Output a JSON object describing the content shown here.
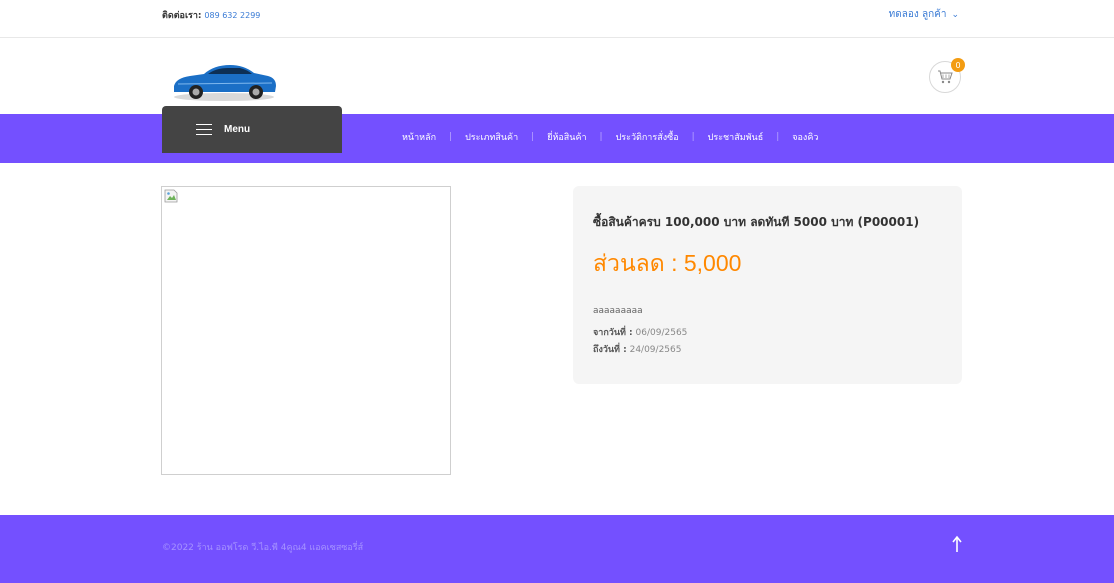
{
  "topbar": {
    "contact_label": "ติดต่อเรา:",
    "phone": "089 632 2299",
    "user_label": "ทดลอง ลูกค้า"
  },
  "cart": {
    "count": "0"
  },
  "nav": {
    "menu_label": "Menu",
    "items": [
      "หน้าหลัก",
      "ประเภทสินค้า",
      "ยี่ห้อสินค้า",
      "ประวัติการสั่งซื้อ",
      "ประชาสัมพันธ์",
      "จองคิว"
    ]
  },
  "promotion": {
    "title": "ซื้อสินค้าครบ 100,000 บาท ลดทันที 5000 บาท (P00001)",
    "discount_label": "ส่วนลด : 5,000",
    "description": "aaaaaaaaa",
    "from_label": "จากวันที่ :",
    "from_date": "06/09/2565",
    "to_label": "ถึงวันที่ :",
    "to_date": "24/09/2565"
  },
  "footer": {
    "copyright": "©2022 ร้าน ออฟโรด วี.ไอ.พี 4คูณ4 แอคเซสซอรี่ส์"
  },
  "colors": {
    "accent": "#7450ff",
    "menu_button": "#444444",
    "discount": "#ff8800",
    "badge": "#f39c12",
    "link": "#3a7bd5"
  },
  "icons": {
    "menu": "hamburger-icon",
    "cart": "cart-icon",
    "user_dropdown": "chevron-down-icon",
    "back_to_top": "arrow-up-icon",
    "broken_image": "broken-image-icon"
  }
}
